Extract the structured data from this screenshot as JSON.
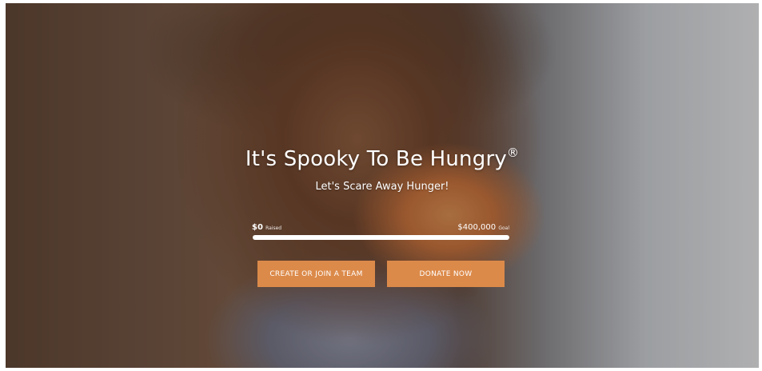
{
  "hero": {
    "title": "It's Spooky To Be Hungry",
    "title_mark": "®",
    "subtitle": "Let's Scare Away Hunger!"
  },
  "fundraising": {
    "raised_amount": "$0",
    "raised_label": "Raised",
    "goal_amount": "$400,000",
    "goal_label": "Goal",
    "progress_fraction": 0.0
  },
  "actions": {
    "team_label": "CREATE OR JOIN A TEAM",
    "donate_label": "DONATE NOW"
  },
  "colors": {
    "accent": "#dc8a4a",
    "text": "#ffffff"
  }
}
